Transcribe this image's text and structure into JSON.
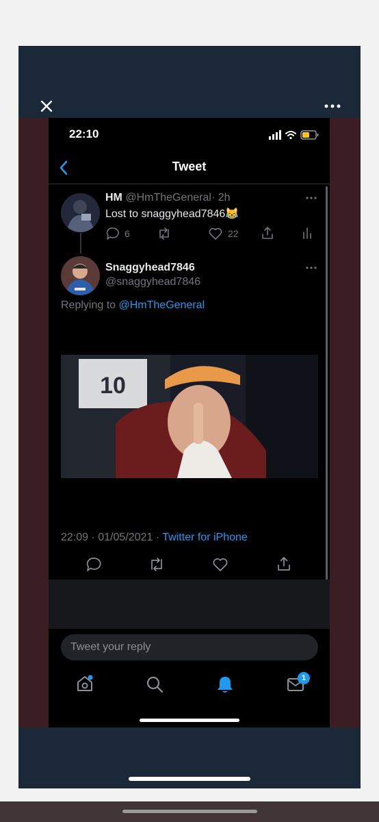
{
  "status_bar": {
    "time": "22:10"
  },
  "header": {
    "title": "Tweet"
  },
  "parent_tweet": {
    "display_name": "HM",
    "handle": "@HmTheGeneral",
    "separator": "·",
    "age": "2h",
    "text": "Lost to snaggyhead7846😹",
    "reply_count": "6",
    "like_count": "22"
  },
  "main_tweet": {
    "display_name": "Snaggyhead7846",
    "handle": "@snaggyhead7846",
    "replying_prefix": "Replying to",
    "replying_to": "@HmTheGeneral",
    "jersey_number": "10",
    "time": "22:09",
    "separator": "·",
    "date": "01/05/2021",
    "separator2": "·",
    "source": "Twitter for iPhone"
  },
  "reply_box": {
    "placeholder": "Tweet your reply"
  },
  "tab_bar": {
    "messages_badge": "1"
  },
  "colors": {
    "accent": "#1d9bf0",
    "background": "#000000",
    "muted": "#71767b"
  }
}
